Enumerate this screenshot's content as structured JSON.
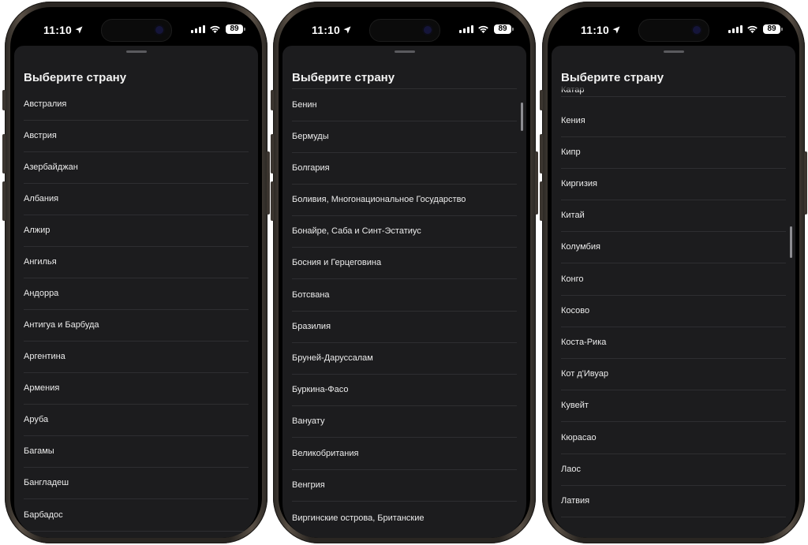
{
  "status": {
    "time": "11:10",
    "battery": "89"
  },
  "sheet": {
    "title": "Выберите страну"
  },
  "panels": [
    {
      "items": [
        "Австралия",
        "Австрия",
        "Азербайджан",
        "Албания",
        "Алжир",
        "Ангилья",
        "Андорра",
        "Антигуа и Барбуда",
        "Аргентина",
        "Армения",
        "Аруба",
        "Багамы",
        "Бангладеш",
        "Барбадос"
      ]
    },
    {
      "items": [
        "Бенин",
        "Бермуды",
        "Болгария",
        "Боливия, Многонациональное Государство",
        "Бонайре, Саба и Синт-Эстатиус",
        "Босния и Герцеговина",
        "Ботсвана",
        "Бразилия",
        "Бруней-Даруссалам",
        "Буркина-Фасо",
        "Вануату",
        "Великобритания",
        "Венгрия",
        "Виргинские острова, Британские"
      ]
    },
    {
      "items": [
        "Катар",
        "Кения",
        "Кипр",
        "Киргизия",
        "Китай",
        "Колумбия",
        "Конго",
        "Косово",
        "Коста-Рика",
        "Кот д'Ивуар",
        "Кувейт",
        "Кюрасао",
        "Лаос",
        "Латвия"
      ]
    }
  ],
  "colors": {
    "sheet_bg": "#1c1c1e",
    "separator": "#2e2e31",
    "text": "#ececec"
  }
}
